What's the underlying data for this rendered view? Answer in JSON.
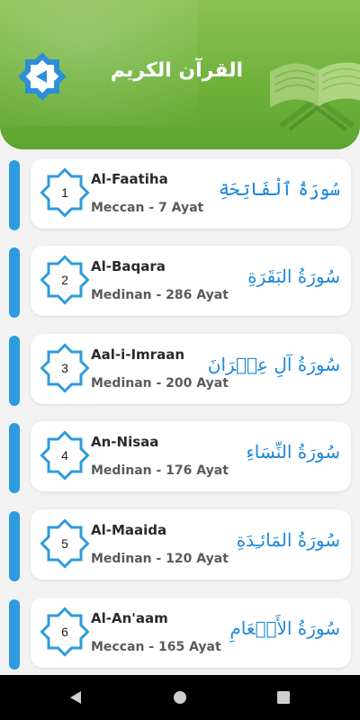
{
  "header": {
    "title": "القرآن الكريم",
    "back_icon": "back-arrow-icon",
    "art_icon": "quran-book-icon",
    "colors": {
      "green_top": "#8cc152",
      "green_bottom": "#5da52f"
    }
  },
  "surahs": [
    {
      "number": "1",
      "name": "Al-Faatiha",
      "details": "Meccan - 7 Ayat",
      "arabic": "سُورَةُ ٱلْفَاتِحَةِ"
    },
    {
      "number": "2",
      "name": "Al-Baqara",
      "details": "Medinan - 286 Ayat",
      "arabic": "سُورَةُ البَقَرَةِ"
    },
    {
      "number": "3",
      "name": "Aal-i-Imraan",
      "details": "Medinan - 200 Ayat",
      "arabic": "سُورَةُ آلِ عِمۡرَانَ"
    },
    {
      "number": "4",
      "name": "An-Nisaa",
      "details": "Medinan - 176 Ayat",
      "arabic": "سُورَةُ النِّسَاءِ"
    },
    {
      "number": "5",
      "name": "Al-Maaida",
      "details": "Medinan - 120 Ayat",
      "arabic": "سُورَةُ المَائـِدَةِ"
    },
    {
      "number": "6",
      "name": "Al-An'aam",
      "details": "Meccan - 165 Ayat",
      "arabic": "سُورَةُ الأَنۡعَامِ"
    }
  ],
  "accent_color": "#2d9be0",
  "navbar": {
    "icons": [
      "back-triangle-icon",
      "home-circle-icon",
      "recents-square-icon"
    ]
  }
}
